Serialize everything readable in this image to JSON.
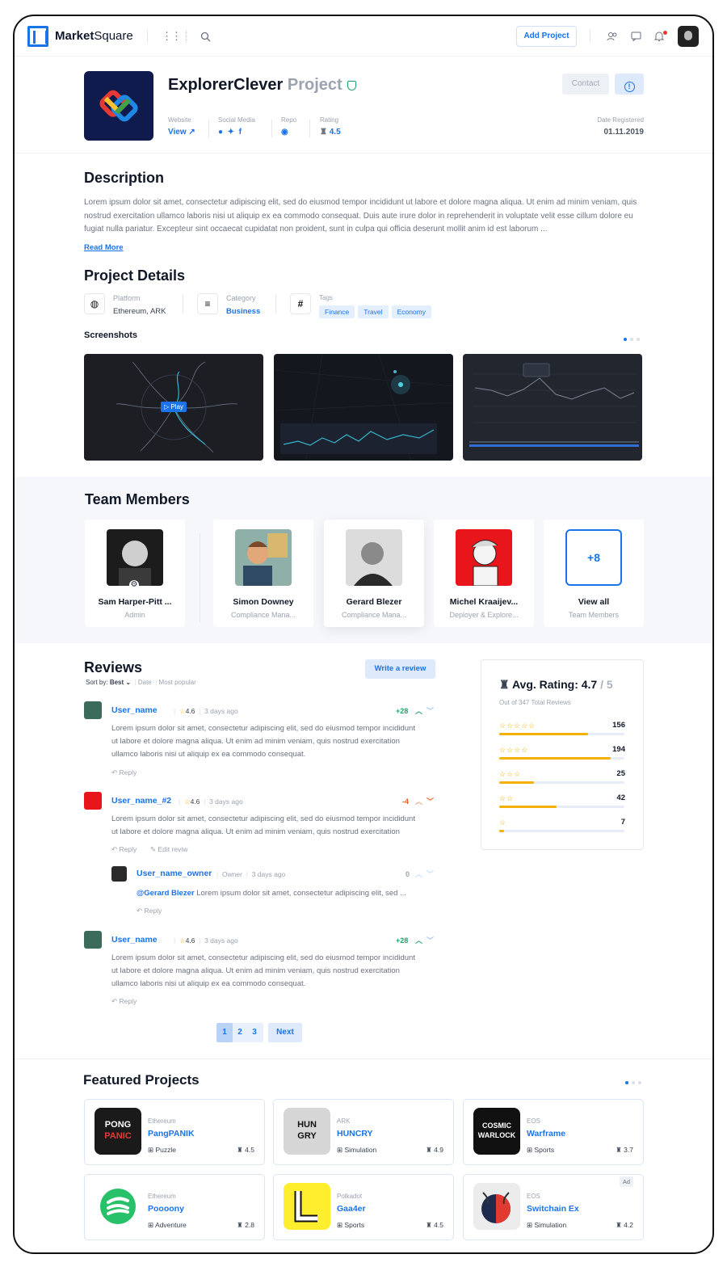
{
  "header": {
    "brand_bold": "Market",
    "brand_light": "Square",
    "add_project": "Add Project"
  },
  "project": {
    "name": "ExplorerClever",
    "suffix": "Project",
    "contact": "Contact",
    "website_label": "Website",
    "website_value": "View",
    "social_label": "Social Media",
    "repo_label": "Repo",
    "rating_label": "Rating",
    "rating_value": "4.5",
    "date_label": "Date Registered",
    "date_value": "01.11.2019"
  },
  "description": {
    "title": "Description",
    "text": "Lorem ipsum dolor sit amet, consectetur adipiscing elit, sed do eiusmod tempor incididunt ut labore et dolore magna aliqua. Ut enim ad minim veniam, quis nostrud exercitation ullamco laboris nisi ut aliquip ex ea commodo consequat. Duis aute irure dolor in reprehenderit in voluptate velit esse cillum dolore eu fugiat nulla pariatur. Excepteur sint occaecat cupidatat non proident, sunt in culpa qui officia deserunt mollit anim id est laborum ...",
    "read_more": "Read More"
  },
  "details": {
    "title": "Project Details",
    "platform_label": "Platform",
    "platform_value": "Ethereum, ARK",
    "category_label": "Category",
    "category_value": "Business",
    "tags_label": "Tags",
    "tags": [
      "Finance",
      "Travel",
      "Economy"
    ],
    "screenshots_title": "Screenshots",
    "play": "Play"
  },
  "team": {
    "title": "Team Members",
    "members": [
      {
        "name": "Sam Harper-Pitt ...",
        "role": "Admin"
      },
      {
        "name": "Simon Downey",
        "role": "Compliance Mana..."
      },
      {
        "name": "Gerard Blezer",
        "role": "Compliance Mana..."
      },
      {
        "name": "Michel Kraaijev...",
        "role": "Deployer & Explore..."
      }
    ],
    "more_count": "+8",
    "view_all": "View all",
    "view_all_sub": "Team Members"
  },
  "reviews": {
    "title": "Reviews",
    "write": "Write a review",
    "sort_label": "Sort by:",
    "sort_best": "Best",
    "sort_date": "Date",
    "sort_popular": "Most popular",
    "items": [
      {
        "user": "User_name",
        "rating": "4.6",
        "time": "3 days ago",
        "votes": "+28",
        "text1": "Lorem ipsum dolor sit amet, consectetur adipiscing elit, sed do eiusmod tempor incididunt",
        "text2": "ut labore et dolore magna aliqua. Ut enim ad minim veniam, quis nostrud exercitation",
        "text3": "ullamco laboris nisi ut aliquip ex ea commodo consequat.",
        "reply": "Reply"
      },
      {
        "user": "User_name_#2",
        "rating": "4.6",
        "time": "3 days ago",
        "votes": "-4",
        "text1": "Lorem ipsum dolor sit amet, consectetur adipiscing elit, sed do eiusmod tempor incididunt",
        "text2": "ut labore et dolore magna aliqua. Ut enim ad minim veniam, quis nostrud exercitation",
        "reply": "Reply",
        "edit": "Edit reviw"
      },
      {
        "user": "User_name_owner",
        "badge": "Owner",
        "time": "3 days ago",
        "votes": "0",
        "mention": "@Gerard Blezer",
        "text1": " Lorem ipsum dolor sit amet, consectetur adipiscing elit, sed ...",
        "reply": "Reply"
      },
      {
        "user": "User_name",
        "rating": "4.6",
        "time": "3 days ago",
        "votes": "+28",
        "text1": "Lorem ipsum dolor sit amet, consectetur adipiscing elit, sed do eiusmod tempor incididunt",
        "text2": "ut labore et dolore magna aliqua. Ut enim ad minim veniam, quis nostrud exercitation",
        "text3": "ullamco laboris nisi ut aliquip ex ea commodo consequat.",
        "reply": "Reply"
      }
    ],
    "pages": [
      "1",
      "2",
      "3"
    ],
    "next": "Next"
  },
  "avg": {
    "title": "Avg. Rating:",
    "value": "4.7",
    "out_of": "/ 5",
    "total": "Out of 347 Total Reviews",
    "rows": [
      {
        "stars": "☆☆☆☆☆",
        "count": "156",
        "fill": 0.71
      },
      {
        "stars": "☆☆☆☆",
        "count": "194",
        "fill": 0.89
      },
      {
        "stars": "☆☆☆",
        "count": "25",
        "fill": 0.28
      },
      {
        "stars": "☆☆",
        "count": "42",
        "fill": 0.46
      },
      {
        "stars": "☆",
        "count": "7",
        "fill": 0.04
      }
    ]
  },
  "featured": {
    "title": "Featured Projects",
    "items": [
      {
        "platform": "Ethereum",
        "name": "PangPANIK",
        "category": "Puzzle",
        "rating": "4.5",
        "logo": "PONG PANIC"
      },
      {
        "platform": "ARK",
        "name": "HUNCRY",
        "category": "Simulation",
        "rating": "4.9",
        "logo": "HUN GRY"
      },
      {
        "platform": "EOS",
        "name": "Warframe",
        "category": "Sports",
        "rating": "3.7",
        "logo": "COSMIC WARLOCK"
      },
      {
        "platform": "Ethereum",
        "name": "Poooony",
        "category": "Adventure",
        "rating": "2.8"
      },
      {
        "platform": "Polkadot",
        "name": "Gaa4er",
        "category": "Sports",
        "rating": "4.5"
      },
      {
        "platform": "EOS",
        "name": "Switchain Ex",
        "category": "Simulation",
        "rating": "4.2",
        "ad": "Ad"
      }
    ]
  }
}
